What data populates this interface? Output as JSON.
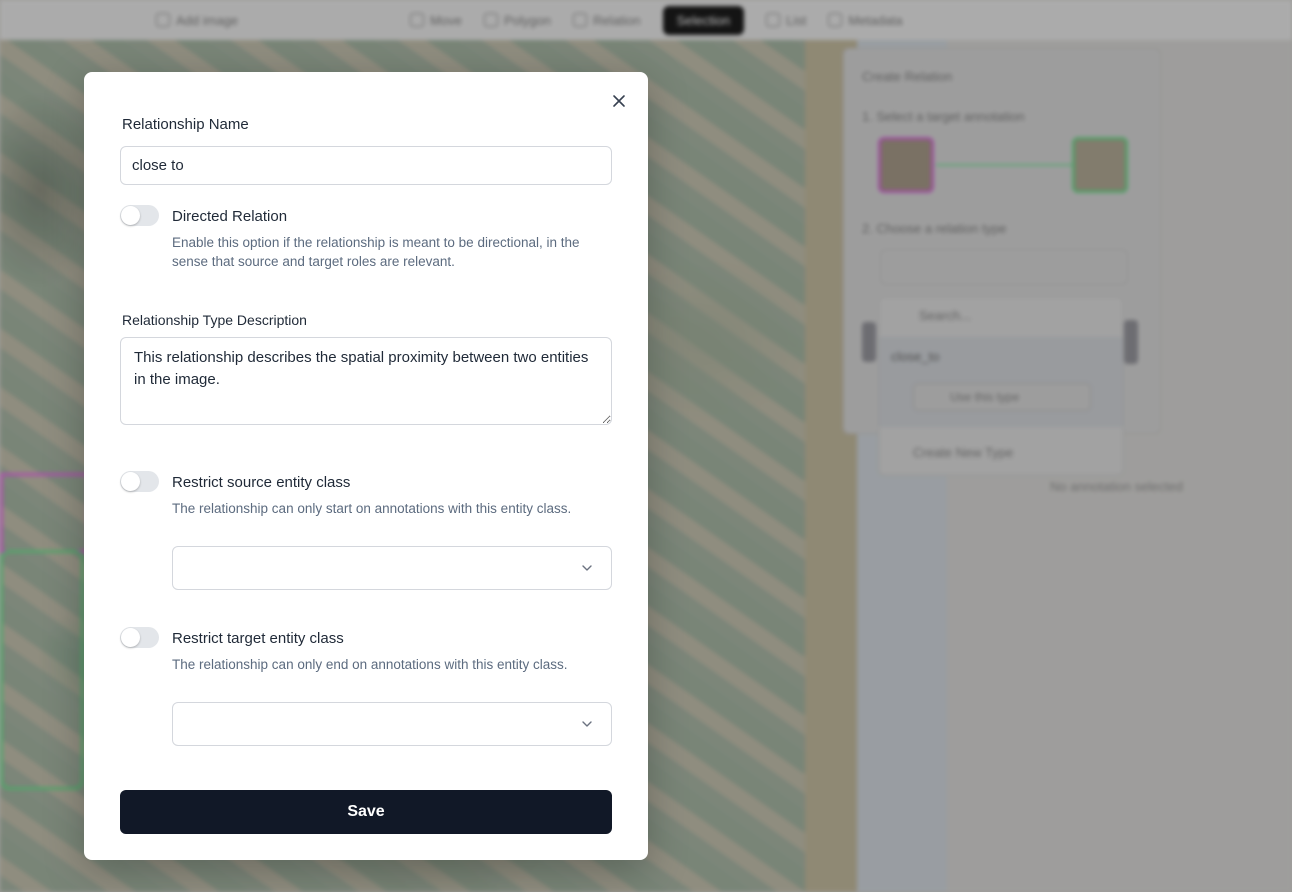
{
  "background": {
    "toolbar": {
      "items": [
        "Add image",
        "Move",
        "Polygon",
        "Relation",
        "Selection",
        "List",
        "Metadata"
      ]
    },
    "relation_panel": {
      "title": "Create Relation",
      "step1": "1. Select a target annotation",
      "step2": "2. Choose a relation type",
      "search_placeholder": "Search...",
      "option": "close_to",
      "use_button": "Use this type",
      "create_new": "Create New Type"
    },
    "no_annotation": "No annotation selected"
  },
  "modal": {
    "name_label": "Relationship Name",
    "name_value": "close to",
    "directed": {
      "title": "Directed Relation",
      "help": "Enable this option if the relationship is meant to be directional, in the sense that source and target roles are relevant.",
      "enabled": false
    },
    "description_label": "Relationship Type Description",
    "description_value": "This relationship describes the spatial proximity between two entities in the image.",
    "source": {
      "title": "Restrict source entity class",
      "help": "The relationship can only start on annotations with this entity class.",
      "enabled": false,
      "selected": ""
    },
    "target": {
      "title": "Restrict target entity class",
      "help": "The relationship can only end on annotations with this entity class.",
      "enabled": false,
      "selected": ""
    },
    "save_label": "Save"
  },
  "colors": {
    "primary_button": "#111827",
    "help_text": "#5c6b7f",
    "toggle_off": "#e3e6ea"
  }
}
